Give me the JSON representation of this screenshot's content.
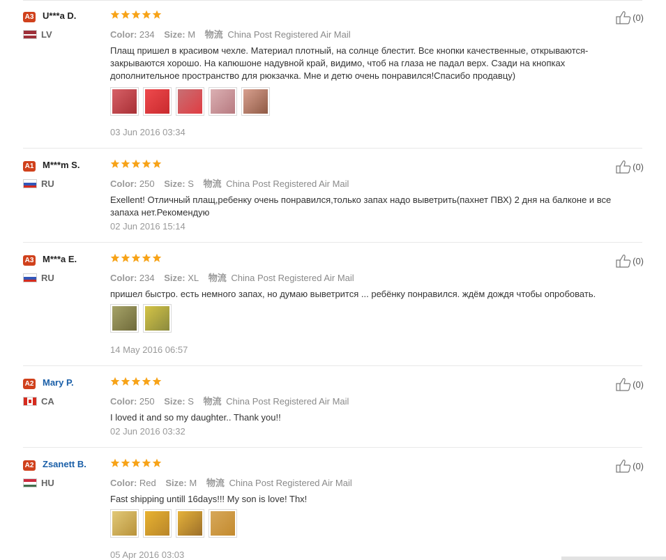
{
  "reviews": [
    {
      "level": "A3",
      "name": "U***a D.",
      "name_link": false,
      "country": "LV",
      "flag": "lv",
      "color_label": "Color:",
      "color": "234",
      "size_label": "Size:",
      "size": "M",
      "ship_cn": "物流",
      "ship": "China Post Registered Air Mail",
      "text": "Плащ пришел в красивом чехле. Материал плотный, на солнце блестит. Все кнопки качественные, открываются-закрываются хорошо. На капюшоне надувной край, видимо, чтоб на глаза не падал верх. Сзади на кнопках дополнительное пространство для рюкзачка. Мне и детю очень понравился!Спасибо продавцу)",
      "photos": [
        "#c9484f",
        "#e23b3e",
        "#b85a5e",
        "#c99a9e",
        "#b07060"
      ],
      "date": "03 Jun 2016 03:34",
      "helpful": "(0)"
    },
    {
      "level": "A1",
      "name": "M***m S.",
      "name_link": false,
      "country": "RU",
      "flag": "ru",
      "color_label": "Color:",
      "color": "250",
      "size_label": "Size:",
      "size": "S",
      "ship_cn": "物流",
      "ship": "China Post Registered Air Mail",
      "text": "Exellent! Отличный плащ,ребенку очень понравился,только запах надо выветрить(пахнет ПВХ) 2 дня на балконе и все запаха нет.Рекомендую",
      "photos": [],
      "date": "02 Jun 2016 15:14",
      "helpful": "(0)"
    },
    {
      "level": "A3",
      "name": "M***a E.",
      "name_link": false,
      "country": "RU",
      "flag": "ru",
      "color_label": "Color:",
      "color": "234",
      "size_label": "Size:",
      "size": "XL",
      "ship_cn": "物流",
      "ship": "China Post Registered Air Mail",
      "text": "пришел быстро. есть немного запах, но думаю выветрится ... ребёнку понравился. ждём дождя чтобы опробовать.",
      "photos": [
        "#8f8a4a",
        "#b8a532"
      ],
      "date": "14 May 2016 06:57",
      "helpful": "(0)"
    },
    {
      "level": "A2",
      "name": "Mary P.",
      "name_link": true,
      "country": "CA",
      "flag": "ca",
      "color_label": "Color:",
      "color": "250",
      "size_label": "Size:",
      "size": "S",
      "ship_cn": "物流",
      "ship": "China Post Registered Air Mail",
      "text": "I loved it and so my daughter.. Thank you!!",
      "photos": [],
      "date": "02 Jun 2016 03:32",
      "helpful": "(0)"
    },
    {
      "level": "A2",
      "name": "Zsanett B.",
      "name_link": true,
      "country": "HU",
      "flag": "hu",
      "color_label": "Color:",
      "color": "Red",
      "size_label": "Size:",
      "size": "M",
      "ship_cn": "物流",
      "ship": "China Post Registered Air Mail",
      "text": "Fast shipping untill 16days!!! My son is love! Thx!",
      "photos": [
        "#d6b24a",
        "#d9a82e",
        "#c9962a",
        "#cfa23a"
      ],
      "date": "05 Apr 2016 03:03",
      "helpful": "(0)"
    }
  ],
  "colors": {
    "star": "#f7a318",
    "badge": "#d0411c",
    "link": "#1a5fa8"
  }
}
